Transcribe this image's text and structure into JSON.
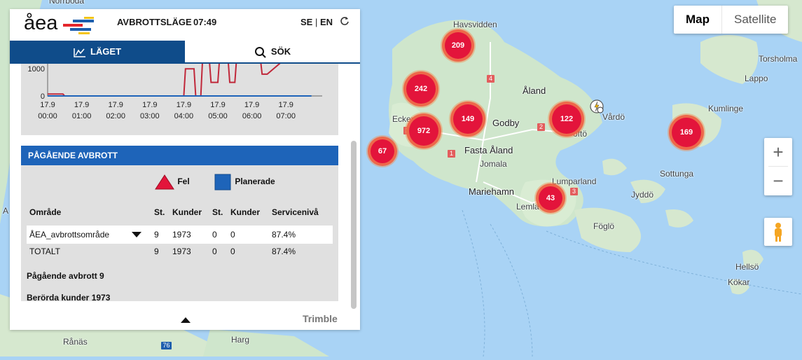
{
  "header": {
    "logo": "åea",
    "title": "AVBROTTSLÄGE",
    "time": "07:49",
    "lang_se": "SE",
    "lang_sep": "|",
    "lang_en": "EN"
  },
  "tabs": [
    {
      "label": "LÄGET",
      "icon": "chart-icon"
    },
    {
      "label": "SÖK",
      "icon": "search-icon"
    }
  ],
  "chart_data": {
    "type": "line",
    "y_ticks": [
      "1000",
      "0"
    ],
    "x_ticks": [
      {
        "date": "17.9",
        "time": "00:00"
      },
      {
        "date": "17.9",
        "time": "01:00"
      },
      {
        "date": "17.9",
        "time": "02:00"
      },
      {
        "date": "17.9",
        "time": "03:00"
      },
      {
        "date": "17.9",
        "time": "04:00"
      },
      {
        "date": "17.9",
        "time": "05:00"
      },
      {
        "date": "17.9",
        "time": "06:00"
      },
      {
        "date": "17.9",
        "time": "07:00"
      }
    ],
    "series": [
      {
        "color": "#c0283a",
        "x": [
          0,
          0.45,
          0.5,
          4.0,
          4.05,
          4.3,
          4.35,
          4.5,
          4.55,
          4.75,
          4.8,
          5.0,
          5.05,
          5.3,
          5.35,
          5.5,
          5.55,
          6.25,
          6.3,
          6.45,
          7.2,
          7.45,
          7.75
        ],
        "values": [
          70,
          70,
          0,
          0,
          1000,
          1000,
          0,
          0,
          1300,
          1300,
          500,
          500,
          1350,
          1350,
          500,
          500,
          1350,
          1350,
          800,
          800,
          1600,
          1400,
          1600
        ]
      },
      {
        "color": "#1e64b9",
        "x": [
          0,
          7.75
        ],
        "values": [
          0,
          0
        ]
      }
    ],
    "ylim": [
      0,
      1700
    ]
  },
  "outage": {
    "heading": "PÅGÅENDE AVBROTT",
    "legend_fault": "Fel",
    "legend_planned": "Planerade",
    "columns": [
      "Område",
      "St.",
      "Kunder",
      "St.",
      "Kunder",
      "Servicenivå"
    ],
    "rows": [
      {
        "area": "ÅEA_avbrottsområde",
        "st1": "9",
        "kunder1": "1973",
        "st2": "0",
        "kunder2": "0",
        "service": "87.4%"
      },
      {
        "area": "TOTALT",
        "st1": "9",
        "kunder1": "1973",
        "st2": "0",
        "kunder2": "0",
        "service": "87.4%"
      }
    ],
    "summary_outages": "Pågående avbrott 9",
    "summary_customers": "Berörda kunder 1973"
  },
  "footer": {
    "brand": "Trimble"
  },
  "map_controls": {
    "map": "Map",
    "satellite": "Satellite",
    "zoom_in": "+",
    "zoom_out": "−"
  },
  "clusters": [
    {
      "label": "209"
    },
    {
      "label": "242"
    },
    {
      "label": "149"
    },
    {
      "label": "972"
    },
    {
      "label": "122"
    },
    {
      "label": "67"
    },
    {
      "label": "43"
    },
    {
      "label": "169"
    }
  ],
  "places": {
    "havsvidden": "Havsvidden",
    "aland": "Åland",
    "godby": "Godby",
    "vardo": "Vårdö",
    "fasta_aland": "Fasta Åland",
    "jomala": "Jomala",
    "mariehamn": "Mariehamn",
    "lumparland": "Lumparland",
    "lemland": "Lemla",
    "foglo": "Föglö",
    "sottunga": "Sottunga",
    "jyddo": "Jyddö",
    "kumlinge": "Kumlinge",
    "torsholma": "Torsholma",
    "lappo": "Lappo",
    "hellso": "Hellsö",
    "kokar": "Kökar",
    "hargs": "Harg",
    "ranas": "Rånäs",
    "eckero": "Ecker",
    "tofto": "öftö",
    "nordboda": "Norrboda",
    "a_letter": "A"
  },
  "road_numbers": [
    "4",
    "1",
    "2",
    "1",
    "3",
    "76"
  ]
}
